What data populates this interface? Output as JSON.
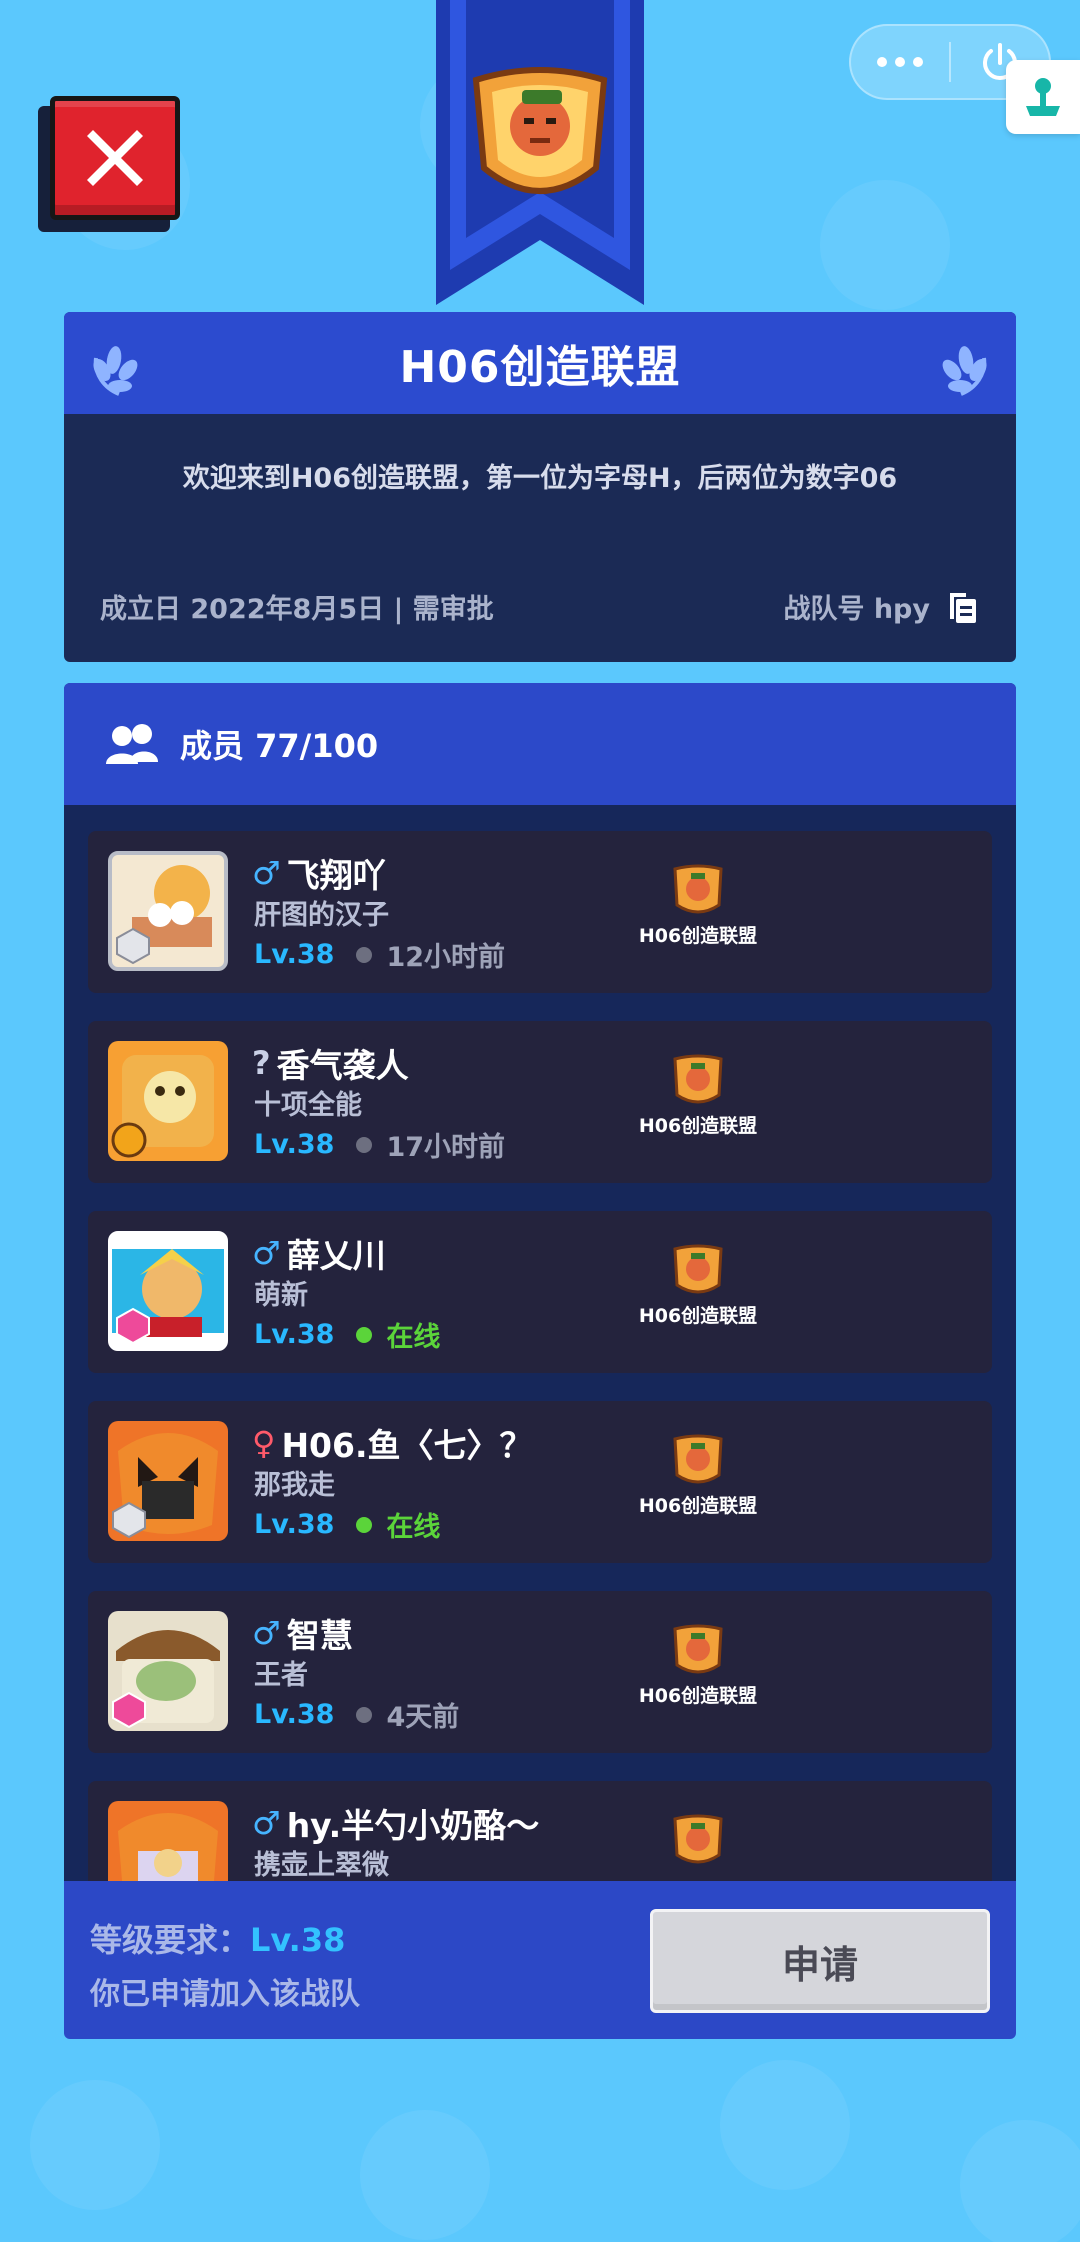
{
  "team": {
    "name": "H06创造联盟",
    "description": "欢迎来到H06创造联盟，第一位为字母H，后两位为数字06",
    "founded": "成立日 2022年8月5日 | 需审批",
    "team_id": "战队号 hpy"
  },
  "members_header": {
    "label": "成员 77/100"
  },
  "members": [
    {
      "gender": "♂",
      "gender_type": "male",
      "name": "飞翔吖",
      "title": "肝图的汉子",
      "level": "Lv.38",
      "status": "12小时前",
      "online": false,
      "team": "H06创造联盟"
    },
    {
      "gender": "?",
      "gender_type": "unknown",
      "name": "香气袭人",
      "title": "十项全能",
      "level": "Lv.38",
      "status": "17小时前",
      "online": false,
      "team": "H06创造联盟"
    },
    {
      "gender": "♂",
      "gender_type": "male",
      "name": "薛乂川",
      "title": "萌新",
      "level": "Lv.38",
      "status": "在线",
      "online": true,
      "team": "H06创造联盟"
    },
    {
      "gender": "♀",
      "gender_type": "female",
      "name": "H06.鱼〈七〉？",
      "title": "那我走",
      "level": "Lv.38",
      "status": "在线",
      "online": true,
      "team": "H06创造联盟"
    },
    {
      "gender": "♂",
      "gender_type": "male",
      "name": "智慧",
      "title": "王者",
      "level": "Lv.38",
      "status": "4天前",
      "online": false,
      "team": "H06创造联盟"
    },
    {
      "gender": "♂",
      "gender_type": "male",
      "name": "hy.半勺小奶酪～",
      "title": "携壶上翠微",
      "level": "",
      "status": "",
      "online": false,
      "team": ""
    }
  ],
  "footer": {
    "requirement_label": "等级要求：",
    "requirement_value": "Lv.38",
    "applied_text": "你已申请加入该战队",
    "apply_button": "申请"
  },
  "colors": {
    "background": "#5bc8fd",
    "accent_blue": "#2c4bcf",
    "panel_dark": "#1b2a55",
    "row_dark": "#24233d",
    "level_blue": "#29b8ff",
    "online_green": "#5bd43a",
    "close_red": "#e0232d"
  },
  "icons": {
    "close": "close-x-icon",
    "more": "more-dots-icon",
    "power": "power-icon",
    "copy": "copy-icon",
    "members": "members-icon",
    "laurel": "laurel-icon",
    "team_emblem": "team-emblem-icon"
  }
}
